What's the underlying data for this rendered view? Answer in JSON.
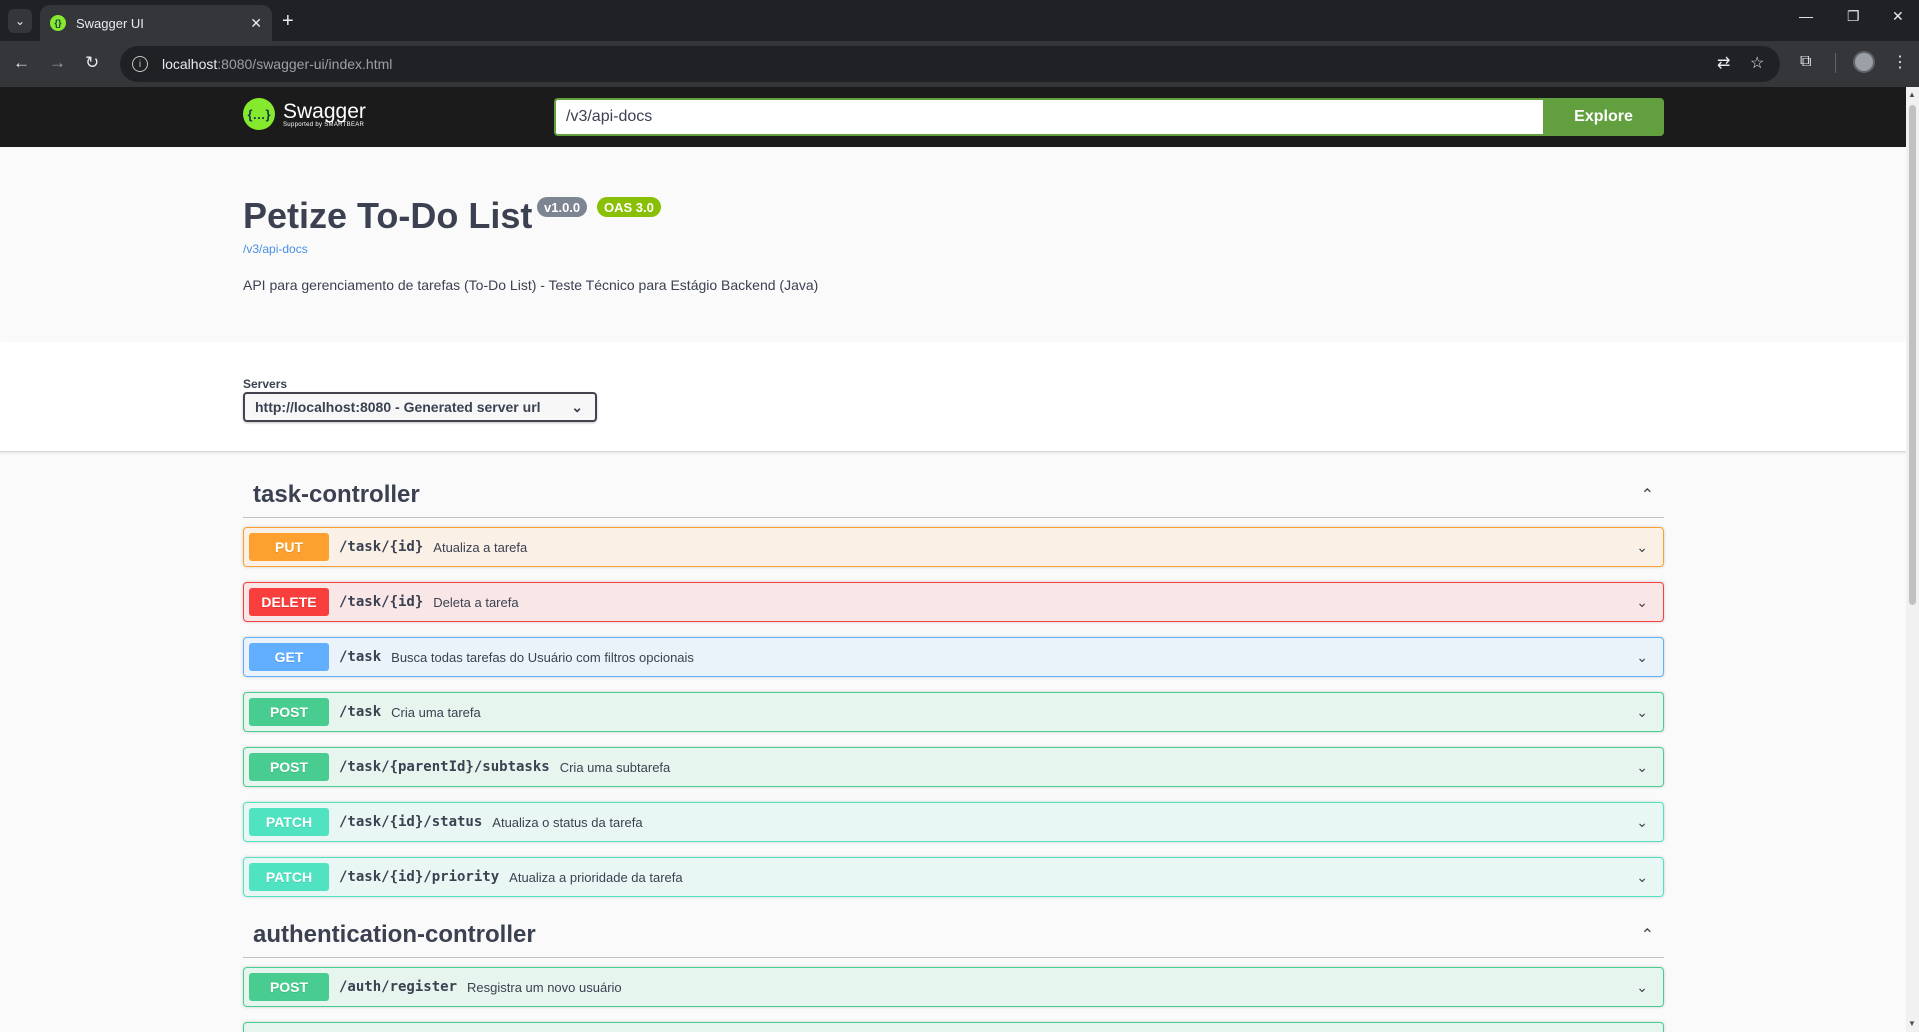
{
  "browser": {
    "tab_title": "Swagger UI",
    "url_host": "localhost",
    "url_rest": ":8080/swagger-ui/index.html"
  },
  "topbar": {
    "logo_name": "Swagger",
    "logo_sub": "Supported by SMARTBEAR",
    "search_value": "/v3/api-docs",
    "explore_label": "Explore"
  },
  "info": {
    "title": "Petize To-Do List",
    "version": "v1.0.0",
    "oas": "OAS 3.0",
    "link": "/v3/api-docs",
    "description": "API para gerenciamento de tarefas (To-Do List) - Teste Técnico para Estágio Backend (Java)"
  },
  "servers": {
    "label": "Servers",
    "selected": "http://localhost:8080 - Generated server url"
  },
  "tags": [
    {
      "name": "task-controller",
      "operations": [
        {
          "method": "PUT",
          "path": "/task/{id}",
          "summary": "Atualiza a tarefa"
        },
        {
          "method": "DELETE",
          "path": "/task/{id}",
          "summary": "Deleta a tarefa"
        },
        {
          "method": "GET",
          "path": "/task",
          "summary": "Busca todas tarefas do Usuário com filtros opcionais"
        },
        {
          "method": "POST",
          "path": "/task",
          "summary": "Cria uma tarefa"
        },
        {
          "method": "POST",
          "path": "/task/{parentId}/subtasks",
          "summary": "Cria uma subtarefa"
        },
        {
          "method": "PATCH",
          "path": "/task/{id}/status",
          "summary": "Atualiza o status da tarefa"
        },
        {
          "method": "PATCH",
          "path": "/task/{id}/priority",
          "summary": "Atualiza a prioridade da tarefa"
        }
      ]
    },
    {
      "name": "authentication-controller",
      "operations": [
        {
          "method": "POST",
          "path": "/auth/register",
          "summary": "Resgistra um novo usuário"
        }
      ]
    }
  ]
}
